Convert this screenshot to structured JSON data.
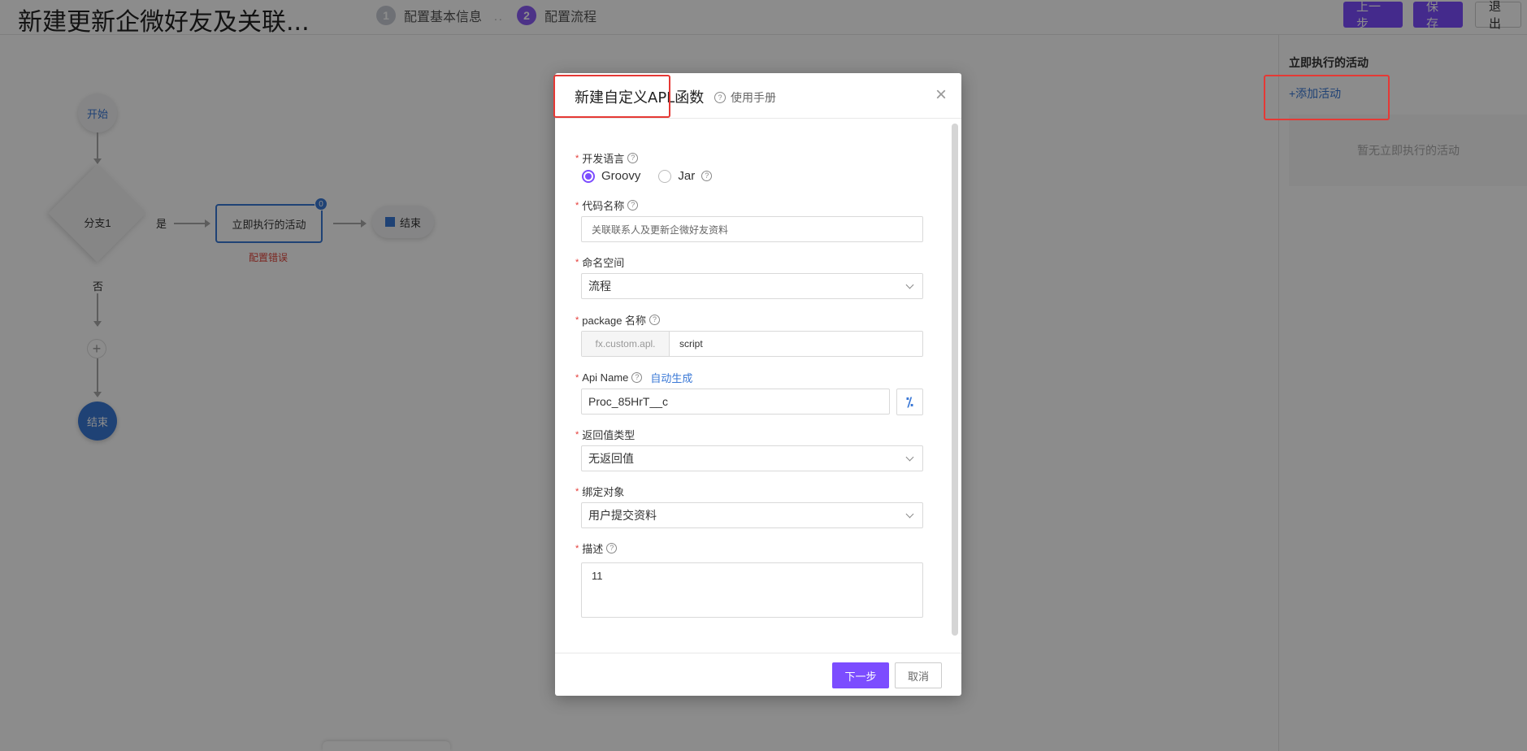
{
  "header": {
    "title": "新建更新企微好友及关联...",
    "steps": [
      {
        "num": "1",
        "label": "配置基本信息"
      },
      {
        "num": "2",
        "label": "配置流程"
      }
    ],
    "step_separator": "..",
    "prev_label": "上一步",
    "save_label": "保存",
    "exit_label": "退出"
  },
  "flow": {
    "start": "开始",
    "branch": "分支1",
    "yes": "是",
    "no": "否",
    "activity": "立即执行的活动",
    "badge": "0",
    "error": "配置错误",
    "end_pill": "结束",
    "plus": "+",
    "end": "结束"
  },
  "right_panel": {
    "title": "立即执行的活动",
    "add_activity": "+添加活动",
    "empty": "暂无立即执行的活动"
  },
  "modal": {
    "title": "新建自定义APL函数",
    "manual": "使用手册",
    "close": "×",
    "fields": {
      "language": {
        "label": "开发语言",
        "options": [
          "Groovy",
          "Jar"
        ]
      },
      "code_name": {
        "label": "代码名称",
        "value": "关联联系人及更新企微好友资料"
      },
      "namespace": {
        "label": "命名空间",
        "value": "流程"
      },
      "package": {
        "label": "package 名称",
        "prefix": "fx.custom.apl.",
        "value": "script"
      },
      "api_name": {
        "label": "Api Name",
        "auto": "自动生成",
        "value": "Proc_85HrT__c"
      },
      "return_type": {
        "label": "返回值类型",
        "value": "无返回值"
      },
      "bind_object": {
        "label": "绑定对象",
        "value": "用户提交资料"
      },
      "description": {
        "label": "描述",
        "value": "11"
      }
    },
    "next_label": "下一步",
    "cancel_label": "取消"
  },
  "colors": {
    "accent": "#7c4dff",
    "link": "#3a78d6",
    "highlight": "#e53935"
  }
}
